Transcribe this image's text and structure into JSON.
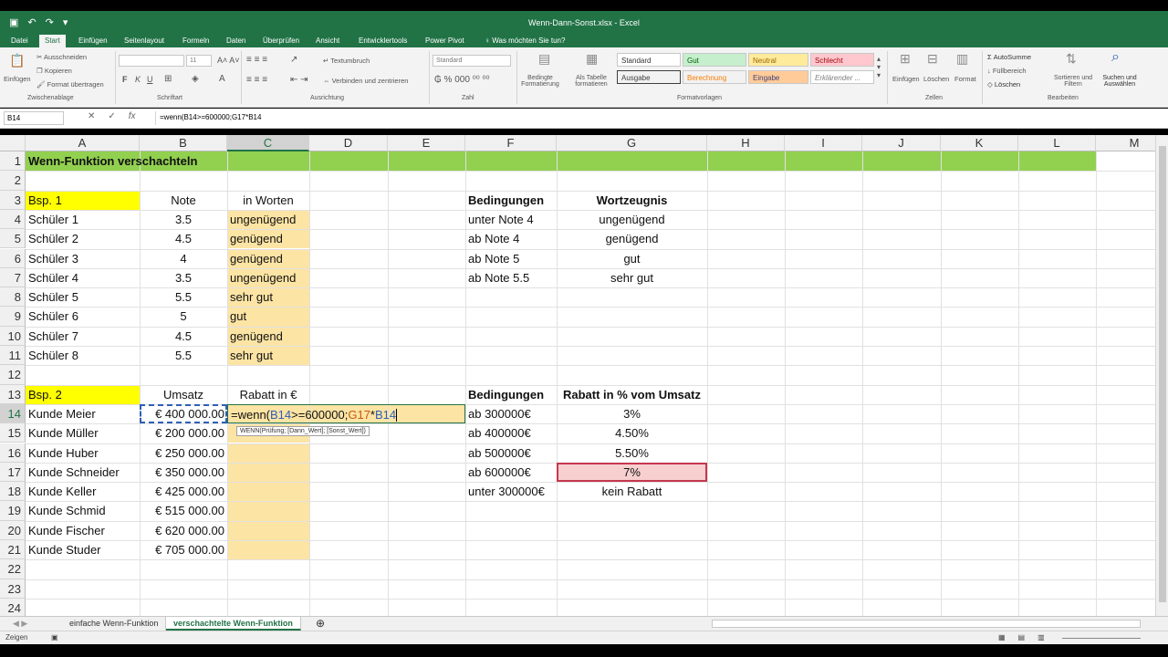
{
  "title_bar": {
    "title": "Wenn-Dann-Sonst.xlsx - Excel"
  },
  "ribbon_tabs": [
    "Datei",
    "Start",
    "Einfügen",
    "Seitenlayout",
    "Formeln",
    "Daten",
    "Überprüfen",
    "Ansicht",
    "Entwicklertools",
    "Power Pivot"
  ],
  "tell_me": "Was möchten Sie tun?",
  "ribbon": {
    "clipboard": {
      "paste": "Einfügen",
      "cut": "Ausschneiden",
      "copy": "Kopieren",
      "format_painter": "Format übertragen",
      "label": "Zwischenablage"
    },
    "font": {
      "size": "11",
      "label": "Schriftart",
      "bold": "F",
      "italic": "K",
      "underline": "U"
    },
    "alignment": {
      "wrap": "Textumbruch",
      "merge": "Verbinden und zentrieren",
      "label": "Ausrichtung"
    },
    "number": {
      "format": "Standard",
      "label": "Zahl"
    },
    "styles": {
      "conditional": "Bedingte Formatierung",
      "as_table": "Als Tabelle formatieren",
      "cells": [
        "Standard",
        "Gut",
        "Neutral",
        "Schlecht",
        "Ausgabe",
        "Berechnung",
        "Eingabe",
        "Erklärender ..."
      ],
      "label": "Formatvorlagen"
    },
    "cells_group": {
      "insert": "Einfügen",
      "delete": "Löschen",
      "format": "Format",
      "label": "Zellen"
    },
    "editing": {
      "autosum": "AutoSumme",
      "fill": "Füllbereich",
      "clear": "Löschen",
      "sort": "Sortieren und Filtern",
      "find": "Suchen und Auswählen",
      "label": "Bearbeiten"
    }
  },
  "formula_bar": {
    "name_box": "B14",
    "formula": "=wenn(B14>=600000;G17*B14"
  },
  "columns": [
    "A",
    "B",
    "C",
    "D",
    "E",
    "F",
    "G",
    "H",
    "I",
    "J",
    "K",
    "L",
    "M"
  ],
  "rows": [
    "1",
    "2",
    "3",
    "4",
    "5",
    "6",
    "7",
    "8",
    "9",
    "10",
    "11",
    "12",
    "13",
    "14",
    "15",
    "16",
    "17",
    "18",
    "19",
    "20",
    "21",
    "22",
    "23",
    "24"
  ],
  "cells": {
    "title": "Wenn-Funktion verschachteln",
    "ex1": {
      "label": "Bsp. 1",
      "col_note": "Note",
      "col_words": "in Worten",
      "students": [
        "Schüler 1",
        "Schüler 2",
        "Schüler 3",
        "Schüler 4",
        "Schüler 5",
        "Schüler 6",
        "Schüler 7",
        "Schüler 8"
      ],
      "notes": [
        "3.5",
        "4.5",
        "4",
        "3.5",
        "5.5",
        "5",
        "4.5",
        "5.5"
      ],
      "words": [
        "ungenügend",
        "genügend",
        "genügend",
        "ungenügend",
        "sehr gut",
        "gut",
        "genügend",
        "sehr gut"
      ]
    },
    "cond1": {
      "h1": "Bedingungen",
      "h2": "Wortzeugnis",
      "conds": [
        "unter Note 4",
        "ab Note 4",
        "ab Note 5",
        "ab Note 5.5"
      ],
      "grades": [
        "ungenügend",
        "genügend",
        "gut",
        "sehr gut"
      ]
    },
    "ex2": {
      "label": "Bsp. 2",
      "col_sales": "Umsatz",
      "col_discount": "Rabatt in €",
      "customers": [
        "Kunde Meier",
        "Kunde Müller",
        "Kunde Huber",
        "Kunde Schneider",
        "Kunde Keller",
        "Kunde Schmid",
        "Kunde Fischer",
        "Kunde Studer"
      ],
      "sales": [
        "€ 400 000.00",
        "€ 200 000.00",
        "€ 250 000.00",
        "€ 350 000.00",
        "€ 425 000.00",
        "€ 515 000.00",
        "€ 620 000.00",
        "€ 705 000.00"
      ]
    },
    "cond2": {
      "h1": "Bedingungen",
      "h2": "Rabatt in % vom Umsatz",
      "conds": [
        "ab 300000€",
        "ab 400000€",
        "ab 500000€",
        "ab 600000€",
        "unter 300000€"
      ],
      "rates": [
        "3%",
        "4.50%",
        "5.50%",
        "7%",
        "kein Rabatt"
      ]
    },
    "editing_formula": {
      "p1": "=wenn(",
      "p2": "B14",
      "p3": ">=600000;",
      "p4": "G17",
      "p5": "*",
      "p6": "B14"
    },
    "tooltip": "WENN(Prüfung; [Dann_Wert]; [Sonst_Wert])"
  },
  "sheet_tabs": [
    "einfache Wenn-Funktion",
    "verschachtelte Wenn-Funktion"
  ],
  "status": {
    "mode": "Zeigen"
  },
  "colors": {
    "excel_green": "#217346",
    "yellow": "#ffff00",
    "orange": "#fce4a4",
    "green": "#92d050",
    "pink": "#f8cfcf",
    "ref_blue": "#2e5fb7",
    "ref_orange": "#c55a11"
  }
}
